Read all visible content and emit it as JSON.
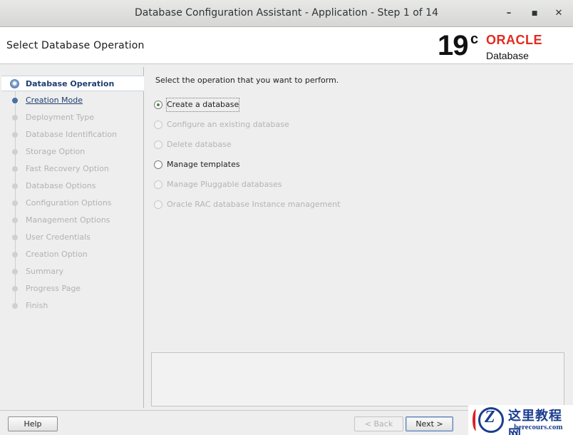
{
  "window": {
    "title": "Database Configuration Assistant - Application - Step 1 of 14",
    "minimize_glyph": "–",
    "maximize_glyph": "■",
    "close_glyph": "✕"
  },
  "header": {
    "page_title": "Select Database Operation",
    "logo": {
      "version": "19",
      "version_suffix": "c",
      "brand": "ORACLE",
      "product": "Database",
      "brand_color": "#e32b1f"
    }
  },
  "steps": [
    {
      "label": "Database Operation",
      "state": "active"
    },
    {
      "label": "Creation Mode",
      "state": "next"
    },
    {
      "label": "Deployment Type",
      "state": "disabled"
    },
    {
      "label": "Database Identification",
      "state": "disabled"
    },
    {
      "label": "Storage Option",
      "state": "disabled"
    },
    {
      "label": "Fast Recovery Option",
      "state": "disabled"
    },
    {
      "label": "Database Options",
      "state": "disabled"
    },
    {
      "label": "Configuration Options",
      "state": "disabled"
    },
    {
      "label": "Management Options",
      "state": "disabled"
    },
    {
      "label": "User Credentials",
      "state": "disabled"
    },
    {
      "label": "Creation Option",
      "state": "disabled"
    },
    {
      "label": "Summary",
      "state": "disabled"
    },
    {
      "label": "Progress Page",
      "state": "disabled"
    },
    {
      "label": "Finish",
      "state": "disabled"
    }
  ],
  "content": {
    "instruction": "Select the operation that you want to perform.",
    "options": [
      {
        "label": "Create a database",
        "selected": true,
        "enabled": true
      },
      {
        "label": "Configure an existing database",
        "selected": false,
        "enabled": false
      },
      {
        "label": "Delete database",
        "selected": false,
        "enabled": false
      },
      {
        "label": "Manage templates",
        "selected": false,
        "enabled": true
      },
      {
        "label": "Manage Pluggable databases",
        "selected": false,
        "enabled": false
      },
      {
        "label": "Oracle RAC database Instance management",
        "selected": false,
        "enabled": false
      }
    ]
  },
  "footer": {
    "help": "Help",
    "back": "< Back",
    "next": "Next >"
  },
  "watermark": {
    "letter": "Z",
    "text_cn": "这里教程网",
    "url": "herecours.com"
  },
  "colors": {
    "accent": "#1f3e70",
    "selected_radio": "#4a8a4a",
    "disabled_text": "#b4b4b4"
  }
}
